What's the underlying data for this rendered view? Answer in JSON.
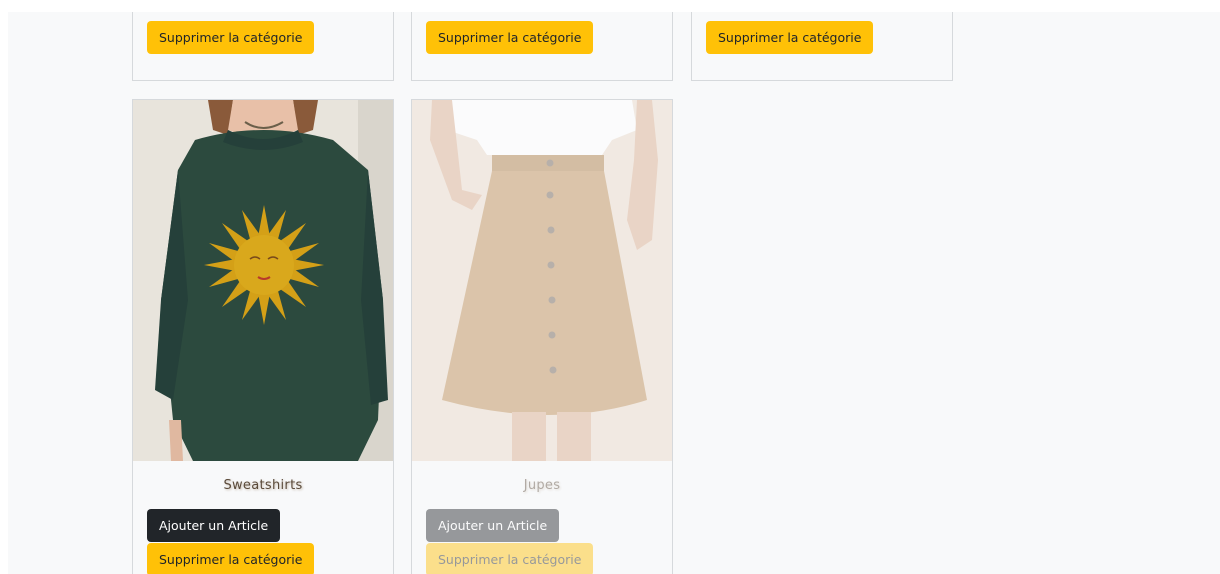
{
  "categories_top": [
    {
      "delete_label": "Supprimer la catégorie"
    },
    {
      "delete_label": "Supprimer la catégorie"
    },
    {
      "delete_label": "Supprimer la catégorie"
    }
  ],
  "categories": [
    {
      "name": "Sweatshirts",
      "add_label": "Ajouter un Article",
      "delete_label": "Supprimer la catégorie",
      "image": "green-sweatshirt-with-sun"
    },
    {
      "name": "Jupes",
      "add_label": "Ajouter un Article",
      "delete_label": "Supprimer la catégorie",
      "image": "tan-button-front-skirt"
    }
  ],
  "colors": {
    "page_bg": "#f8f9fa",
    "btn_dark": "#212529",
    "btn_warning": "#ffc107",
    "card_border": "#d6d9dc"
  }
}
